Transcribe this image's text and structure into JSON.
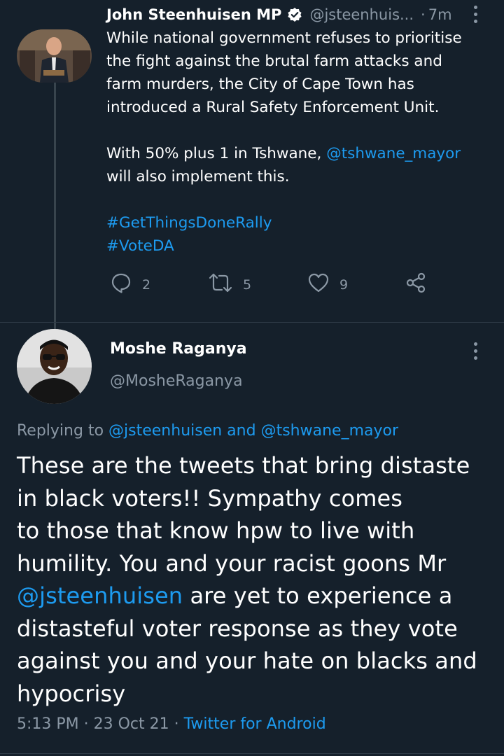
{
  "tweet": {
    "author_name": "John Steenhuisen MP",
    "author_handle": "@jsteenhuis...",
    "separator": "·",
    "time": "7m",
    "text_line1": "While national government refuses to prioritise",
    "text_line2": "the fight against the brutal farm attacks and",
    "text_line3": "farm murders, the City of Cape Town has",
    "text_line4": "introduced a Rural Safety Enforcement Unit.",
    "text_p2_a": "With 50% plus 1 in Tshwane, ",
    "text_p2_mention": "@tshwane_mayor",
    "text_p2_b": "will also implement this.",
    "hashtag1": "#GetThingsDoneRally",
    "hashtag2": "#VoteDA",
    "reply_count": "2",
    "retweet_count": "5",
    "like_count": "9",
    "icons": [
      "verified-icon",
      "more-icon",
      "reply-icon",
      "retweet-icon",
      "like-icon",
      "share-icon"
    ]
  },
  "reply": {
    "author_name": "Moshe Raganya",
    "author_handle": "@MosheRaganya",
    "replying_prefix": "Replying to ",
    "replying_mention1": "@jsteenhuisen",
    "replying_and": " and ",
    "replying_mention2": "@tshwane_mayor",
    "line1": "These are the tweets that bring distaste",
    "line2": "in black voters!! Sympathy comes",
    "line3": "to those that know hpw to live with",
    "line4": "humility. You and your racist goons Mr",
    "line5_mention": "@jsteenhuisen",
    "line5_rest": " are yet to experience a",
    "line6": "distasteful voter response as they vote",
    "line7": "against you and your hate on blacks and",
    "line8": "hypocrisy",
    "timestamp": "5:13 PM · 23 Oct 21 · ",
    "source": "Twitter for Android"
  },
  "colors": {
    "background": "#15202b",
    "text": "#ffffff",
    "secondary": "#8b98a5",
    "link": "#1d9bf0"
  }
}
